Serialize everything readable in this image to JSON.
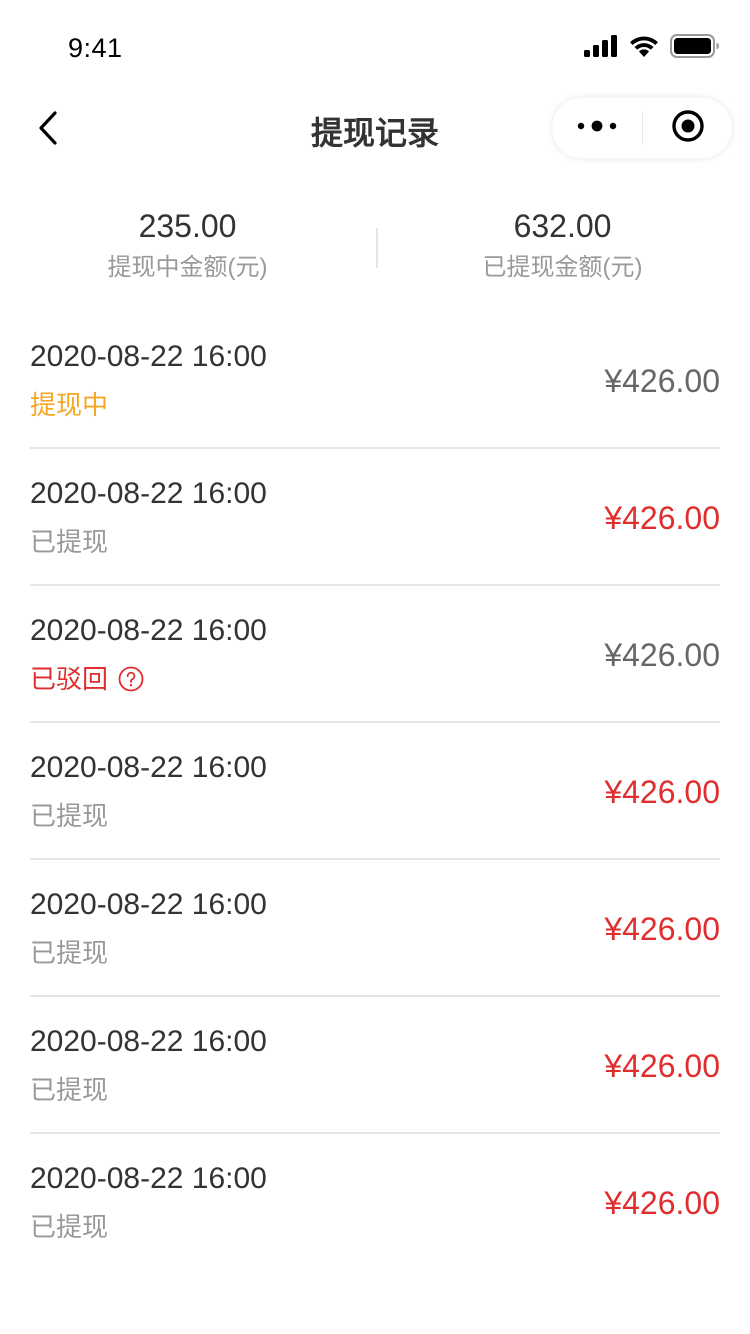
{
  "status_bar": {
    "time": "9:41"
  },
  "nav": {
    "title": "提现记录",
    "icons": {
      "back": "chevron-left-icon",
      "more": "more-dots-icon",
      "close": "target-close-icon"
    }
  },
  "summary": {
    "pending_amount": "235.00",
    "pending_label": "提现中金额(元)",
    "withdrawn_amount": "632.00",
    "withdrawn_label": "已提现金额(元)"
  },
  "colors": {
    "text_primary": "#333333",
    "text_secondary": "#999999",
    "status_pending": "#f5a623",
    "status_rejected": "#e02e2e",
    "amount_success": "#e02e2e",
    "amount_muted": "#666666",
    "divider": "#e6e6e6"
  },
  "records": [
    {
      "datetime": "2020-08-22 16:00",
      "status": "提现中",
      "status_type": "pending",
      "amount": "¥426.00"
    },
    {
      "datetime": "2020-08-22 16:00",
      "status": "已提现",
      "status_type": "success",
      "amount": "¥426.00"
    },
    {
      "datetime": "2020-08-22 16:00",
      "status": "已驳回",
      "status_type": "rejected",
      "amount": "¥426.00"
    },
    {
      "datetime": "2020-08-22 16:00",
      "status": "已提现",
      "status_type": "success",
      "amount": "¥426.00"
    },
    {
      "datetime": "2020-08-22 16:00",
      "status": "已提现",
      "status_type": "success",
      "amount": "¥426.00"
    },
    {
      "datetime": "2020-08-22 16:00",
      "status": "已提现",
      "status_type": "success",
      "amount": "¥426.00"
    },
    {
      "datetime": "2020-08-22 16:00",
      "status": "已提现",
      "status_type": "success",
      "amount": "¥426.00"
    }
  ]
}
